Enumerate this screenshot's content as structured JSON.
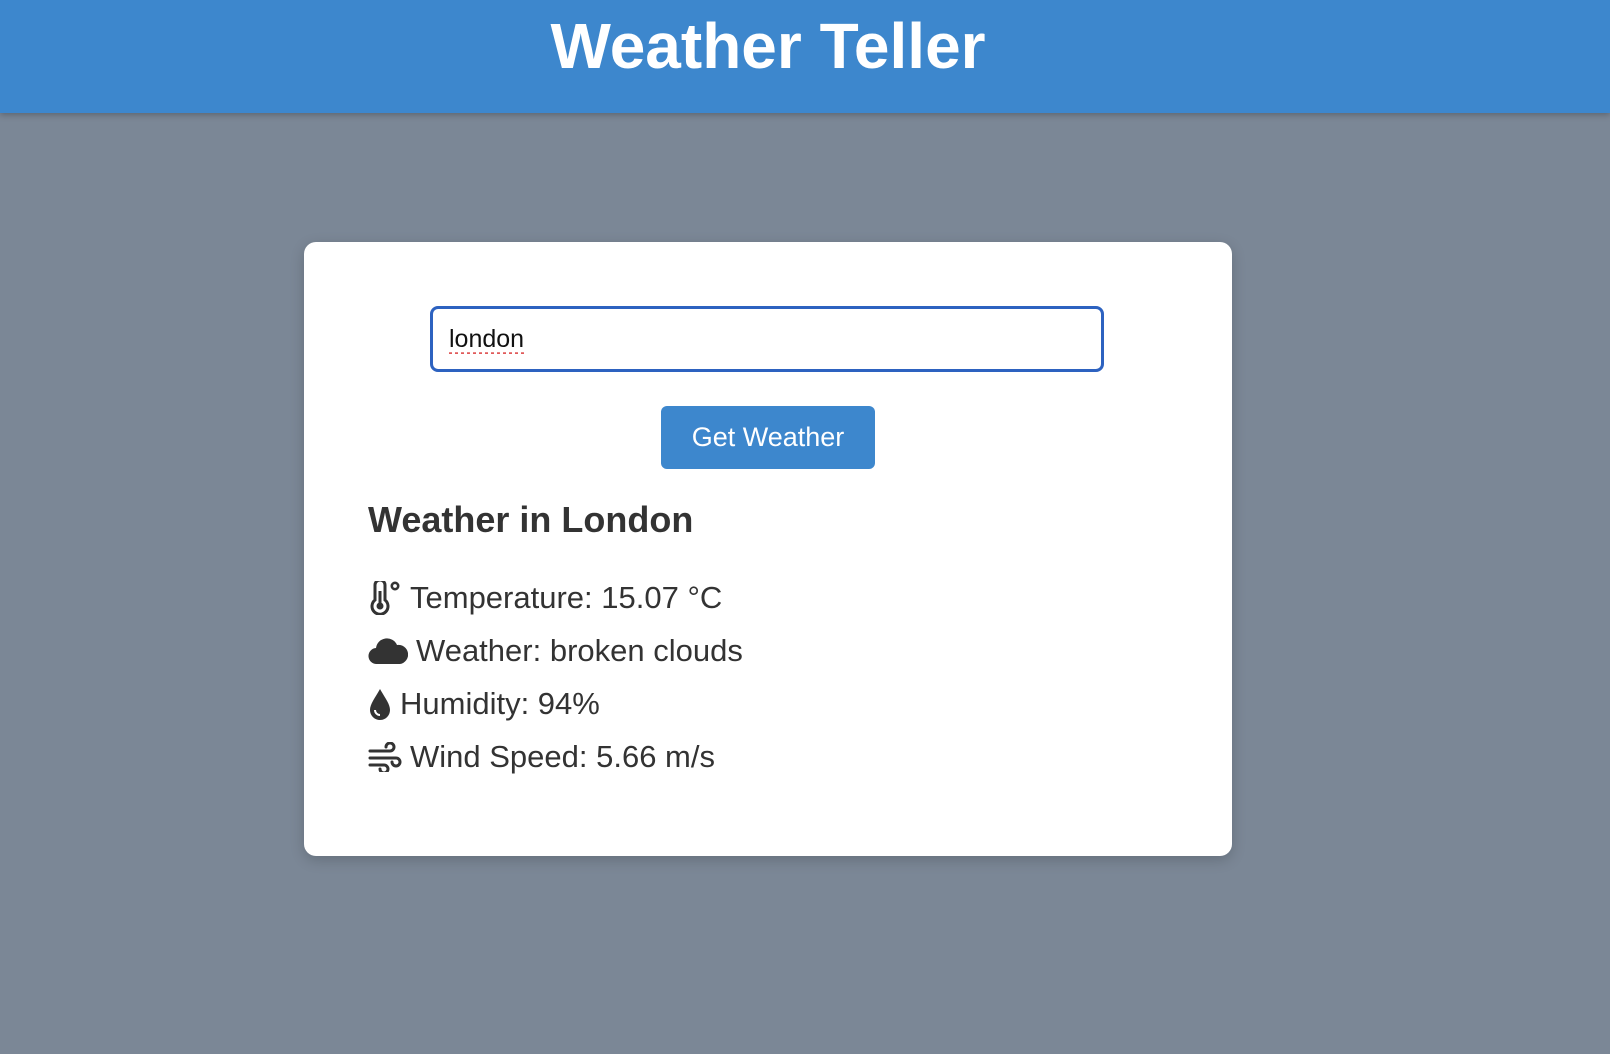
{
  "header": {
    "title": "Weather Teller"
  },
  "search": {
    "value": "london"
  },
  "button": {
    "label": "Get Weather"
  },
  "result": {
    "title": "Weather in London",
    "temperature": "Temperature: 15.07 °C",
    "weather": "Weather: broken clouds",
    "humidity": "Humidity: 94%",
    "wind_speed": "Wind Speed: 5.66 m/s"
  },
  "icons": {
    "temperature": "thermometer-icon",
    "weather": "cloud-icon",
    "humidity": "droplet-icon",
    "wind_speed": "wind-icon"
  },
  "colors": {
    "header_bg": "#3d87cd",
    "page_bg": "#7b8796",
    "card_bg": "#ffffff",
    "button_bg": "#3d87cd",
    "input_border": "#2d62c0",
    "text": "#333333"
  }
}
